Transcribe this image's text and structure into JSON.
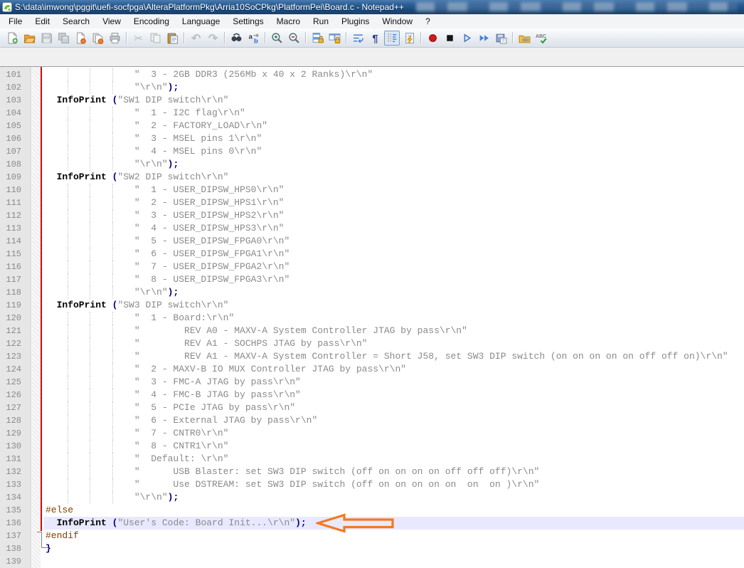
{
  "window": {
    "title": "S:\\data\\imwong\\pggit\\uefi-socfpga\\AlteraPlatformPkg\\Arria10SoCPkg\\PlatformPei\\Board.c - Notepad++",
    "app": "Notepad++"
  },
  "menu": {
    "items": [
      "File",
      "Edit",
      "Search",
      "View",
      "Encoding",
      "Language",
      "Settings",
      "Macro",
      "Run",
      "Plugins",
      "Window",
      "?"
    ]
  },
  "toolbar": {
    "buttons": [
      {
        "name": "new-file"
      },
      {
        "name": "open-file"
      },
      {
        "name": "save-file",
        "state": "disabled"
      },
      {
        "name": "save-all",
        "state": "disabled"
      },
      {
        "name": "close-file"
      },
      {
        "name": "close-all"
      },
      {
        "name": "print"
      },
      {
        "name": "cut",
        "state": "disabled",
        "sep": true
      },
      {
        "name": "copy",
        "state": "disabled"
      },
      {
        "name": "paste"
      },
      {
        "name": "undo",
        "state": "disabled",
        "sep": true
      },
      {
        "name": "redo",
        "state": "disabled"
      },
      {
        "name": "find",
        "sep": true
      },
      {
        "name": "replace"
      },
      {
        "name": "zoom-in",
        "sep": true
      },
      {
        "name": "zoom-out"
      },
      {
        "name": "sync-vertical",
        "sep": true
      },
      {
        "name": "sync-horizontal"
      },
      {
        "name": "word-wrap",
        "sep": true
      },
      {
        "name": "show-all-characters"
      },
      {
        "name": "show-indent-guide",
        "state": "pressed"
      },
      {
        "name": "document-map"
      },
      {
        "name": "macro-record",
        "sep": true
      },
      {
        "name": "macro-stop"
      },
      {
        "name": "macro-play"
      },
      {
        "name": "macro-run-multiple"
      },
      {
        "name": "macro-save"
      },
      {
        "name": "open-folder",
        "sep": true
      },
      {
        "name": "spell-check"
      }
    ]
  },
  "colors": {
    "string": "#8a8a8a",
    "operator": "#000080",
    "preprocessor": "#804000",
    "current_line_bg": "#e8e8ff",
    "change_marker": "#e60000",
    "annotation_arrow": "#f4791f"
  },
  "editor": {
    "lines": [
      {
        "num": 101,
        "guides": true,
        "segments": [
          {
            "t": "str",
            "v": "                \"  3 - 2GB DDR3 (256Mb x 40 x 2 Ranks)\\r\\n\""
          }
        ]
      },
      {
        "num": 102,
        "guides": true,
        "segments": [
          {
            "t": "str",
            "v": "                \"\\r\\n\""
          },
          {
            "t": "op",
            "v": ");"
          }
        ]
      },
      {
        "num": 103,
        "segments": [
          {
            "t": "kw",
            "v": "  InfoPrint "
          },
          {
            "t": "op",
            "v": "("
          },
          {
            "t": "str",
            "v": "\"SW1 DIP switch\\r\\n\""
          }
        ]
      },
      {
        "num": 104,
        "guides": true,
        "segments": [
          {
            "t": "str",
            "v": "                \"  1 - I2C flag\\r\\n\""
          }
        ]
      },
      {
        "num": 105,
        "guides": true,
        "segments": [
          {
            "t": "str",
            "v": "                \"  2 - FACTORY_LOAD\\r\\n\""
          }
        ]
      },
      {
        "num": 106,
        "guides": true,
        "segments": [
          {
            "t": "str",
            "v": "                \"  3 - MSEL pins 1\\r\\n\""
          }
        ]
      },
      {
        "num": 107,
        "guides": true,
        "segments": [
          {
            "t": "str",
            "v": "                \"  4 - MSEL pins 0\\r\\n\""
          }
        ]
      },
      {
        "num": 108,
        "guides": true,
        "segments": [
          {
            "t": "str",
            "v": "                \"\\r\\n\""
          },
          {
            "t": "op",
            "v": ");"
          }
        ]
      },
      {
        "num": 109,
        "segments": [
          {
            "t": "kw",
            "v": "  InfoPrint "
          },
          {
            "t": "op",
            "v": "("
          },
          {
            "t": "str",
            "v": "\"SW2 DIP switch\\r\\n\""
          }
        ]
      },
      {
        "num": 110,
        "guides": true,
        "segments": [
          {
            "t": "str",
            "v": "                \"  1 - USER_DIPSW_HPS0\\r\\n\""
          }
        ]
      },
      {
        "num": 111,
        "guides": true,
        "segments": [
          {
            "t": "str",
            "v": "                \"  2 - USER_DIPSW_HPS1\\r\\n\""
          }
        ]
      },
      {
        "num": 112,
        "guides": true,
        "segments": [
          {
            "t": "str",
            "v": "                \"  3 - USER_DIPSW_HPS2\\r\\n\""
          }
        ]
      },
      {
        "num": 113,
        "guides": true,
        "segments": [
          {
            "t": "str",
            "v": "                \"  4 - USER_DIPSW_HPS3\\r\\n\""
          }
        ]
      },
      {
        "num": 114,
        "guides": true,
        "segments": [
          {
            "t": "str",
            "v": "                \"  5 - USER_DIPSW_FPGA0\\r\\n\""
          }
        ]
      },
      {
        "num": 115,
        "guides": true,
        "segments": [
          {
            "t": "str",
            "v": "                \"  6 - USER_DIPSW_FPGA1\\r\\n\""
          }
        ]
      },
      {
        "num": 116,
        "guides": true,
        "segments": [
          {
            "t": "str",
            "v": "                \"  7 - USER_DIPSW_FPGA2\\r\\n\""
          }
        ]
      },
      {
        "num": 117,
        "guides": true,
        "segments": [
          {
            "t": "str",
            "v": "                \"  8 - USER_DIPSW_FPGA3\\r\\n\""
          }
        ]
      },
      {
        "num": 118,
        "guides": true,
        "segments": [
          {
            "t": "str",
            "v": "                \"\\r\\n\""
          },
          {
            "t": "op",
            "v": ");"
          }
        ]
      },
      {
        "num": 119,
        "segments": [
          {
            "t": "kw",
            "v": "  InfoPrint "
          },
          {
            "t": "op",
            "v": "("
          },
          {
            "t": "str",
            "v": "\"SW3 DIP switch\\r\\n\""
          }
        ]
      },
      {
        "num": 120,
        "guides": true,
        "segments": [
          {
            "t": "str",
            "v": "                \"  1 - Board:\\r\\n\""
          }
        ]
      },
      {
        "num": 121,
        "guides": true,
        "segments": [
          {
            "t": "str",
            "v": "                \"        REV A0 - MAXV-A System Controller JTAG by pass\\r\\n\""
          }
        ]
      },
      {
        "num": 122,
        "guides": true,
        "segments": [
          {
            "t": "str",
            "v": "                \"        REV A1 - SOCHPS JTAG by pass\\r\\n\""
          }
        ]
      },
      {
        "num": 123,
        "guides": true,
        "segments": [
          {
            "t": "str",
            "v": "                \"        REV A1 - MAXV-A System Controller = Short J58, set SW3 DIP switch (on on on on on off off on)\\r\\n\""
          }
        ]
      },
      {
        "num": 124,
        "guides": true,
        "segments": [
          {
            "t": "str",
            "v": "                \"  2 - MAXV-B IO MUX Controller JTAG by pass\\r\\n\""
          }
        ]
      },
      {
        "num": 125,
        "guides": true,
        "segments": [
          {
            "t": "str",
            "v": "                \"  3 - FMC-A JTAG by pass\\r\\n\""
          }
        ]
      },
      {
        "num": 126,
        "guides": true,
        "segments": [
          {
            "t": "str",
            "v": "                \"  4 - FMC-B JTAG by pass\\r\\n\""
          }
        ]
      },
      {
        "num": 127,
        "guides": true,
        "segments": [
          {
            "t": "str",
            "v": "                \"  5 - PCIe JTAG by pass\\r\\n\""
          }
        ]
      },
      {
        "num": 128,
        "guides": true,
        "segments": [
          {
            "t": "str",
            "v": "                \"  6 - External JTAG by pass\\r\\n\""
          }
        ]
      },
      {
        "num": 129,
        "guides": true,
        "segments": [
          {
            "t": "str",
            "v": "                \"  7 - CNTR0\\r\\n\""
          }
        ]
      },
      {
        "num": 130,
        "guides": true,
        "segments": [
          {
            "t": "str",
            "v": "                \"  8 - CNTR1\\r\\n\""
          }
        ]
      },
      {
        "num": 131,
        "guides": true,
        "segments": [
          {
            "t": "str",
            "v": "                \"  Default: \\r\\n\""
          }
        ]
      },
      {
        "num": 132,
        "guides": true,
        "segments": [
          {
            "t": "str",
            "v": "                \"      USB Blaster: set SW3 DIP switch (off on on on on off off off)\\r\\n\""
          }
        ]
      },
      {
        "num": 133,
        "guides": true,
        "segments": [
          {
            "t": "str",
            "v": "                \"      Use DSTREAM: set SW3 DIP switch (off on on on on on  on  on )\\r\\n\""
          }
        ]
      },
      {
        "num": 134,
        "guides": true,
        "segments": [
          {
            "t": "str",
            "v": "                \"\\r\\n\""
          },
          {
            "t": "op",
            "v": ");"
          }
        ]
      },
      {
        "num": 135,
        "segments": [
          {
            "t": "pre",
            "v": "#else"
          }
        ]
      },
      {
        "num": 136,
        "highlight": true,
        "segments": [
          {
            "t": "kw",
            "v": "  InfoPrint "
          },
          {
            "t": "op",
            "v": "("
          },
          {
            "t": "str",
            "v": "\"User's Code: Board Init...\\r\\n\""
          },
          {
            "t": "op",
            "v": ");"
          }
        ]
      },
      {
        "num": 137,
        "segments": [
          {
            "t": "pre",
            "v": "#endif"
          }
        ]
      },
      {
        "num": 138,
        "segments": [
          {
            "t": "op",
            "v": "}"
          }
        ]
      },
      {
        "num": 139,
        "segments": []
      }
    ]
  }
}
